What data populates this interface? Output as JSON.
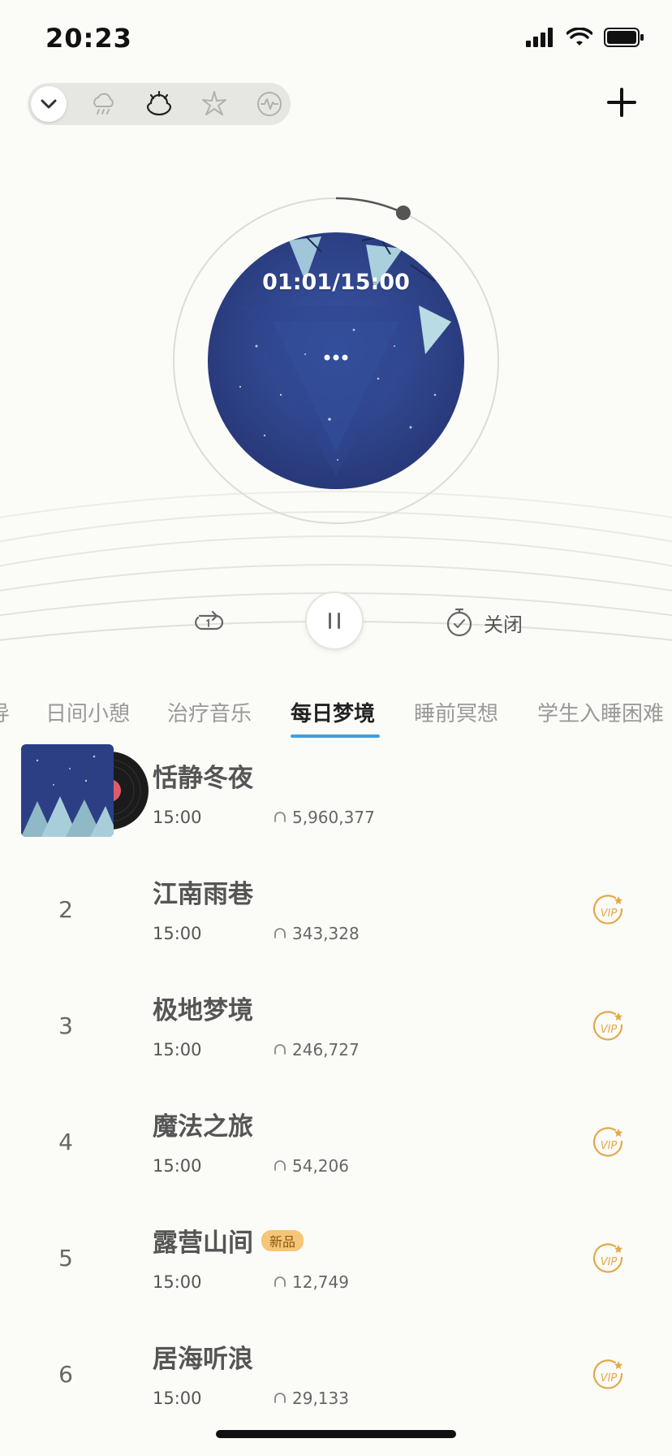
{
  "status_bar": {
    "time": "20:23"
  },
  "scene_selector": {
    "items": [
      {
        "icon": "chevron-down-icon"
      },
      {
        "icon": "rain-cloud-icon"
      },
      {
        "icon": "sunset-icon"
      },
      {
        "icon": "sparkle-icon"
      },
      {
        "icon": "sound-wave-icon"
      }
    ]
  },
  "header": {
    "add_icon": "plus-icon"
  },
  "player": {
    "progress_text": "01:01/15:00",
    "progress_fraction": 0.068,
    "more_label": "•••",
    "timer_label": "关闭"
  },
  "tabs": [
    {
      "label": "导"
    },
    {
      "label": "日间小憩"
    },
    {
      "label": "治疗音乐"
    },
    {
      "label": "每日梦境",
      "active": true
    },
    {
      "label": "睡前冥想"
    },
    {
      "label": "学生入睡困难"
    }
  ],
  "list": [
    {
      "num": "",
      "title": "恬静冬夜",
      "duration": "15:00",
      "plays": "5,960,377",
      "vip": false,
      "playing": true
    },
    {
      "num": "2",
      "title": "江南雨巷",
      "duration": "15:00",
      "plays": "343,328",
      "vip": true
    },
    {
      "num": "3",
      "title": "极地梦境",
      "duration": "15:00",
      "plays": "246,727",
      "vip": true
    },
    {
      "num": "4",
      "title": "魔法之旅",
      "duration": "15:00",
      "plays": "54,206",
      "vip": true
    },
    {
      "num": "5",
      "title": "露营山间",
      "badge": "新品",
      "duration": "15:00",
      "plays": "12,749",
      "vip": true
    },
    {
      "num": "6",
      "title": "居海听浪",
      "duration": "15:00",
      "plays": "29,133",
      "vip": true
    }
  ],
  "colors": {
    "accent": "#3da0e0",
    "vip": "#e3a94a",
    "disc": "#2d3f82"
  }
}
